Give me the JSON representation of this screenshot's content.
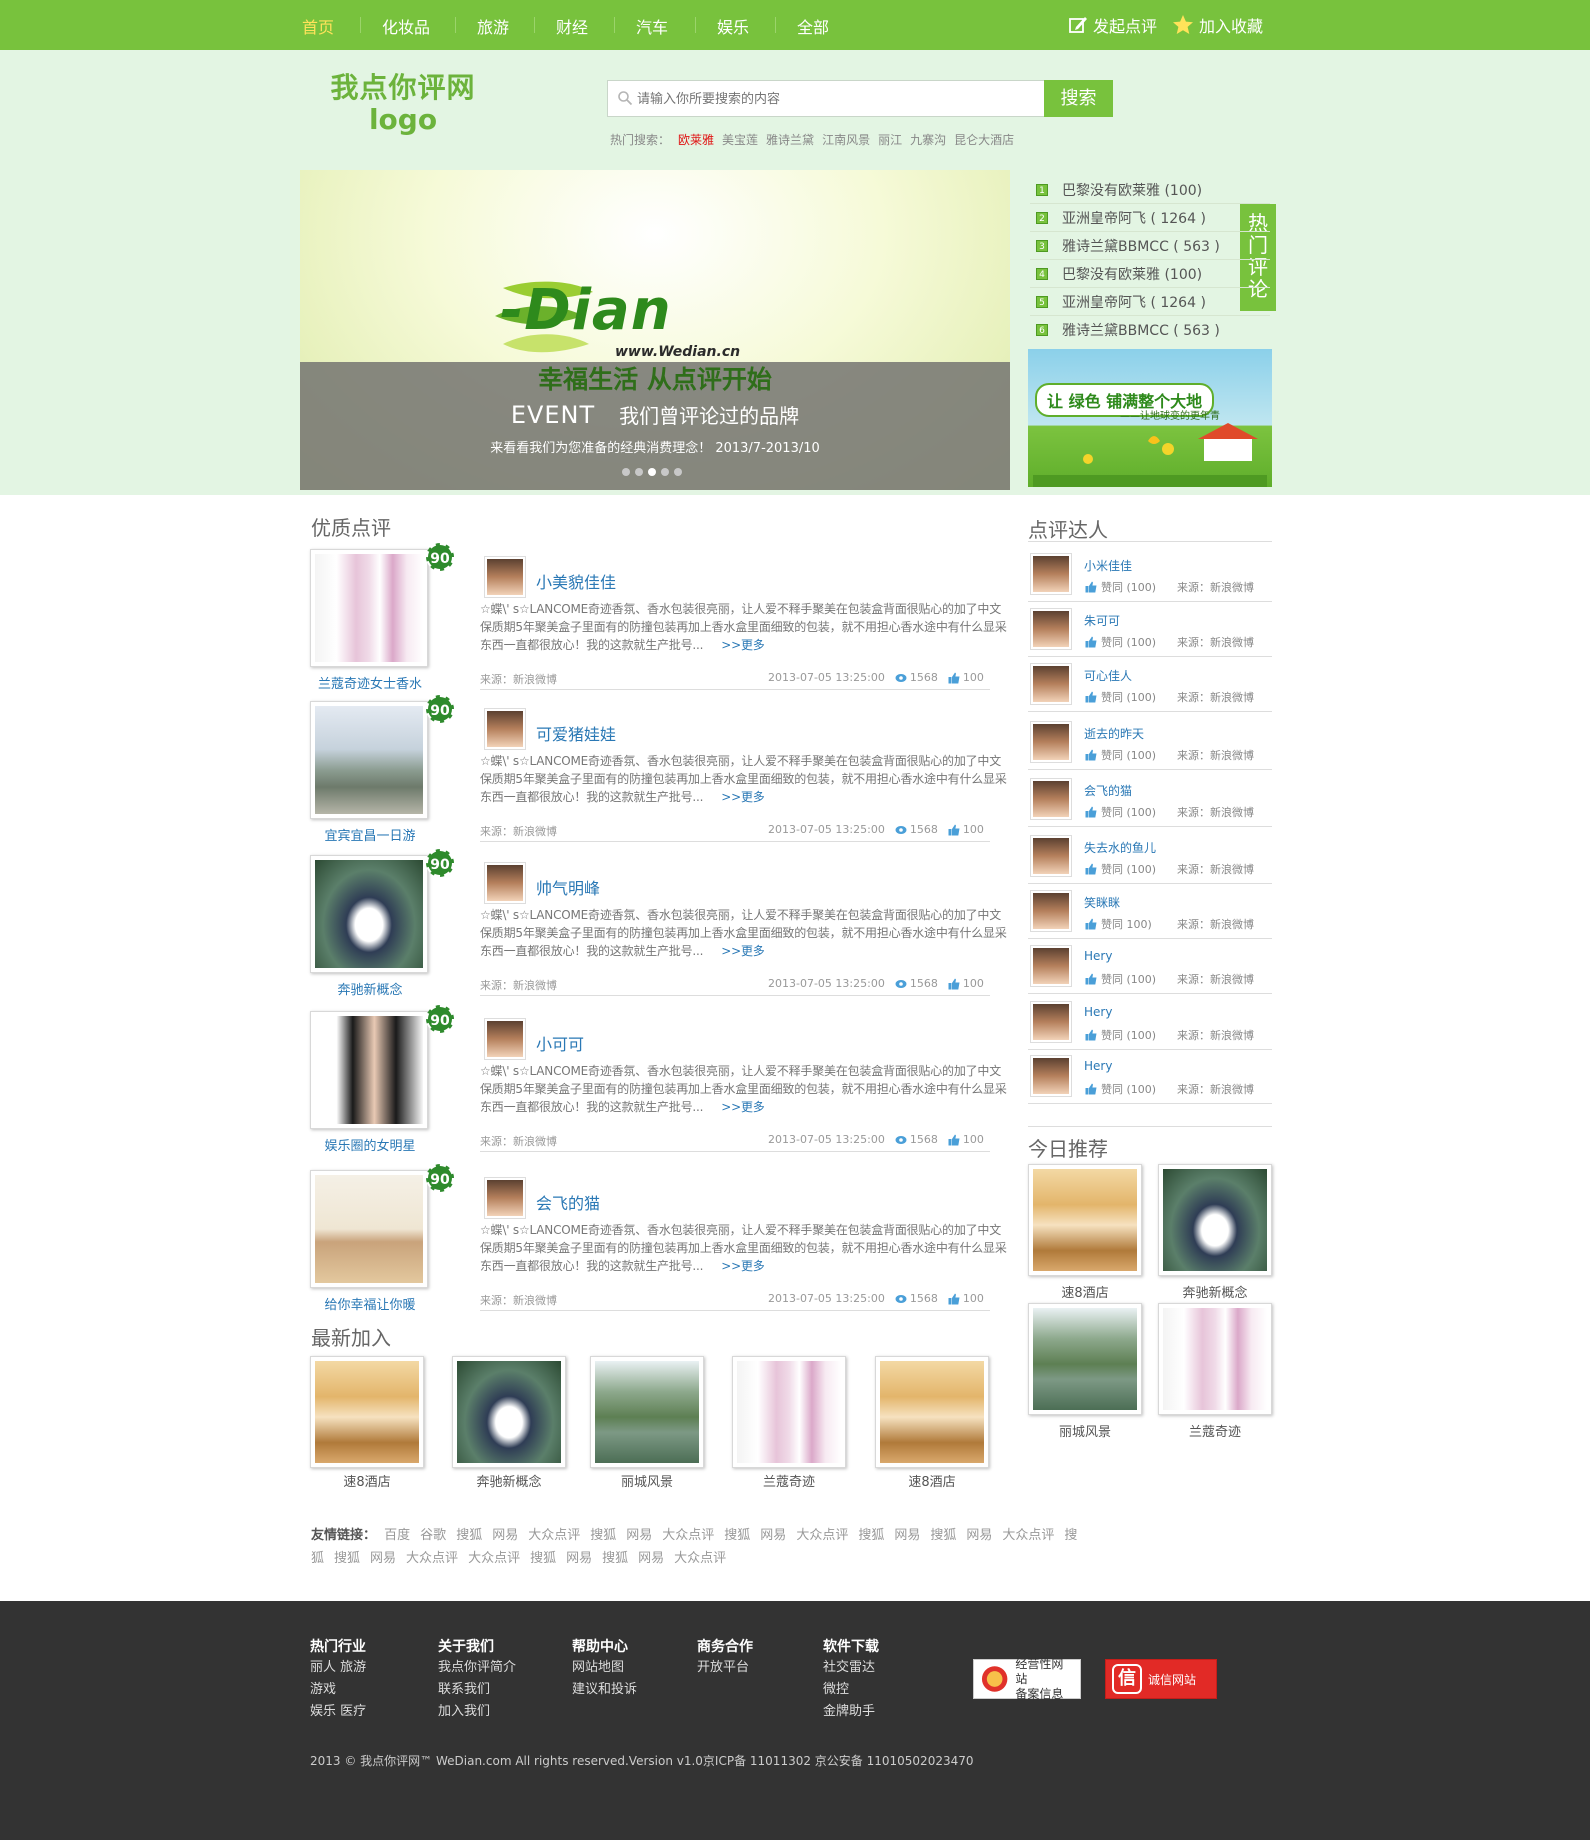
{
  "nav": {
    "items": [
      "首页",
      "化妆品",
      "旅游",
      "财经",
      "汽车",
      "娱乐",
      "全部"
    ],
    "active": "首页",
    "post_review": "发起点评",
    "favorite": "加入收藏"
  },
  "logo": {
    "line1": "我点你评网",
    "line2": "logo"
  },
  "search": {
    "placeholder": "请输入你所要搜索的内容",
    "button": "搜索",
    "hot_label": "热门搜索：",
    "hot_terms": [
      "欧莱雅",
      "美宝莲",
      "雅诗兰黛",
      "江南风景",
      "丽江",
      "九寨沟",
      "昆仑大酒店"
    ]
  },
  "banner": {
    "brand": "-Dian",
    "url": "www.Wedian.cn",
    "slogan": "幸福生活  从点评开始",
    "event": "EVENT",
    "event_text": "我们曾评论过的品牌",
    "sub": "来看看我们为您准备的经典消费理念！  2013/7-2013/10",
    "dots": 5,
    "active_dot": 3
  },
  "hot_reviews": {
    "tag": "热门评论",
    "items": [
      {
        "n": "1",
        "text": "巴黎没有欧莱雅 (100)"
      },
      {
        "n": "2",
        "text": "亚洲皇帝阿飞 ( 1264 )"
      },
      {
        "n": "3",
        "text": "雅诗兰黛BBMCC ( 563 )"
      },
      {
        "n": "4",
        "text": "巴黎没有欧莱雅 (100)"
      },
      {
        "n": "5",
        "text": "亚洲皇帝阿飞 ( 1264 )"
      },
      {
        "n": "6",
        "text": "雅诗兰黛BBMCC ( 563 )"
      }
    ]
  },
  "ad": {
    "text": "让 绿色 铺满整个大地",
    "sub": "——让地球变的更年青"
  },
  "quality": {
    "title": "优质点评",
    "items": [
      {
        "score": "90",
        "product": "兰蔻奇迹女士香水",
        "img": "perfume",
        "user": "小美貌佳佳",
        "desc": "☆蝶\\' s☆LANCOME奇迹香氛、香水包装很亮丽，让人爱不释手聚美在包装盒背面很贴心的加了中文保质期5年聚美盒子里面有的防撞包装再加上香水盒里面细致的包装，就不用担心香水途中有什么显采东西一直都很放心！我的这款就生产批号...",
        "more": ">>更多",
        "source": "来源：新浪微博",
        "date": "2013-07-05  13:25:00",
        "views": "1568",
        "likes": "100"
      },
      {
        "score": "90",
        "product": "宜宾宜昌一日游",
        "img": "street",
        "user": "可爱猪娃娃",
        "desc": "☆蝶\\' s☆LANCOME奇迹香氛、香水包装很亮丽，让人爱不释手聚美在包装盒背面很贴心的加了中文保质期5年聚美盒子里面有的防撞包装再加上香水盒里面细致的包装，就不用担心香水途中有什么显采东西一直都很放心！我的这款就生产批号...",
        "more": ">>更多",
        "source": "来源：新浪微博",
        "date": "2013-07-05  13:25:00",
        "views": "1568",
        "likes": "100"
      },
      {
        "score": "90",
        "product": "奔驰新概念",
        "img": "car",
        "user": "帅气明峰",
        "desc": "☆蝶\\' s☆LANCOME奇迹香氛、香水包装很亮丽，让人爱不释手聚美在包装盒背面很贴心的加了中文保质期5年聚美盒子里面有的防撞包装再加上香水盒里面细致的包装，就不用担心香水途中有什么显采东西一直都很放心！我的这款就生产批号...",
        "more": ">>更多",
        "source": "来源：新浪微博",
        "date": "2013-07-05  13:25:00",
        "views": "1568",
        "likes": "100"
      },
      {
        "score": "90",
        "product": "娱乐圈的女明星",
        "img": "woman",
        "user": "小可可",
        "desc": "☆蝶\\' s☆LANCOME奇迹香氛、香水包装很亮丽，让人爱不释手聚美在包装盒背面很贴心的加了中文保质期5年聚美盒子里面有的防撞包装再加上香水盒里面细致的包装，就不用担心香水途中有什么显采东西一直都很放心！我的这款就生产批号...",
        "more": ">>更多",
        "source": "来源：新浪微博",
        "date": "2013-07-05  13:25:00",
        "views": "1568",
        "likes": "100"
      },
      {
        "score": "90",
        "product": "给你幸福让你暖",
        "img": "living",
        "user": "会飞的猫",
        "desc": "☆蝶\\' s☆LANCOME奇迹香氛、香水包装很亮丽，让人爱不释手聚美在包装盒背面很贴心的加了中文保质期5年聚美盒子里面有的防撞包装再加上香水盒里面细致的包装，就不用担心香水途中有什么显采东西一直都很放心！我的这款就生产批号...",
        "more": ">>更多",
        "source": "来源：新浪微博",
        "date": "2013-07-05  13:25:00",
        "views": "1568",
        "likes": "100"
      }
    ]
  },
  "reviewers": {
    "title": "点评达人",
    "items": [
      {
        "name": "小米佳佳",
        "like": "赞同 (100)",
        "source": "来源：新浪微博"
      },
      {
        "name": "朱可可",
        "like": "赞同 (100)",
        "source": "来源：新浪微博"
      },
      {
        "name": "可心佳人",
        "like": "赞同 (100)",
        "source": "来源：新浪微博"
      },
      {
        "name": "逝去的昨天",
        "like": "赞同 (100)",
        "source": "来源：新浪微博"
      },
      {
        "name": "会飞的猫",
        "like": "赞同 (100)",
        "source": "来源：新浪微博"
      },
      {
        "name": "失去水的鱼儿",
        "like": "赞同 (100)",
        "source": "来源：新浪微博"
      },
      {
        "name": "笑眯眯",
        "like": "赞同 100)",
        "source": "来源：新浪微博"
      },
      {
        "name": "Hery",
        "like": "赞同 (100)",
        "source": "来源：新浪微博"
      },
      {
        "name": "Hery",
        "like": "赞同 (100)",
        "source": "来源：新浪微博"
      },
      {
        "name": "Hery",
        "like": "赞同 (100)",
        "source": "来源：新浪微博"
      }
    ]
  },
  "today": {
    "title": "今日推荐",
    "items": [
      {
        "label": "速8酒店",
        "img": "room"
      },
      {
        "label": "奔驰新概念",
        "img": "car"
      },
      {
        "label": "丽城风景",
        "img": "lake"
      },
      {
        "label": "兰蔻奇迹",
        "img": "perfume"
      }
    ]
  },
  "newest": {
    "title": "最新加入",
    "items": [
      {
        "label": "速8酒店",
        "img": "room"
      },
      {
        "label": "奔驰新概念",
        "img": "car"
      },
      {
        "label": "丽城风景",
        "img": "lake"
      },
      {
        "label": "兰蔻奇迹",
        "img": "perfume"
      },
      {
        "label": "速8酒店",
        "img": "room"
      }
    ]
  },
  "links": {
    "label": "友情链接：",
    "items": [
      "百度",
      "谷歌",
      "搜狐",
      "网易",
      "大众点评",
      "搜狐",
      "网易",
      "大众点评",
      "搜狐",
      "网易",
      "大众点评",
      "搜狐",
      "网易",
      "搜狐",
      "网易",
      "大众点评",
      "搜狐",
      "搜狐",
      "网易",
      "大众点评",
      "大众点评",
      "搜狐",
      "网易",
      "搜狐",
      "网易",
      "大众点评"
    ]
  },
  "footer": {
    "cols": [
      {
        "title": "热门行业",
        "items": [
          "丽人  旅游",
          "游戏",
          "娱乐  医疗"
        ]
      },
      {
        "title": "关于我们",
        "items": [
          "我点你评简介",
          "联系我们",
          "加入我们"
        ]
      },
      {
        "title": "帮助中心",
        "items": [
          "网站地图",
          "建议和投诉"
        ]
      },
      {
        "title": "商务合作",
        "items": [
          "开放平台"
        ]
      },
      {
        "title": "软件下载",
        "items": [
          "社交雷达",
          "微控",
          "金牌助手"
        ]
      }
    ],
    "cert1": "经营性网站\n备案信息",
    "cert2": "诚信网站",
    "cert2_icon": "信",
    "copyright": "2013 © 我点你评网™ WeDian.com All rights reserved.Version v1.0京ICP备 11011302 京公安备 11010502023470"
  }
}
